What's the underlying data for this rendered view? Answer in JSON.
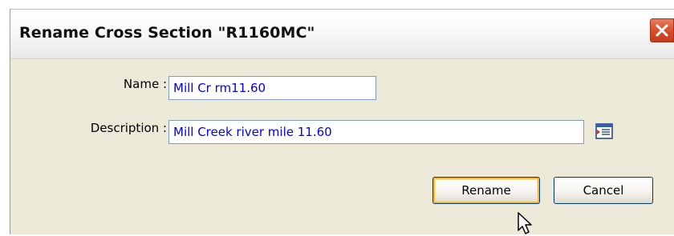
{
  "dialog": {
    "title": "Rename Cross Section \"R1160MC\"",
    "close_icon": "close-icon"
  },
  "form": {
    "name_label": "Name :",
    "name_value": "Mill Cr rm11.60",
    "description_label": "Description :",
    "description_value": "Mill Creek river mile 11.60",
    "description_editor_icon": "text-editor-icon"
  },
  "buttons": {
    "rename_label": "Rename",
    "cancel_label": "Cancel"
  },
  "colors": {
    "dialog_bg": "#ece9d8",
    "field_text": "#0000ee",
    "close_button": "#d9532f",
    "default_button_highlight": "#f8b636"
  }
}
